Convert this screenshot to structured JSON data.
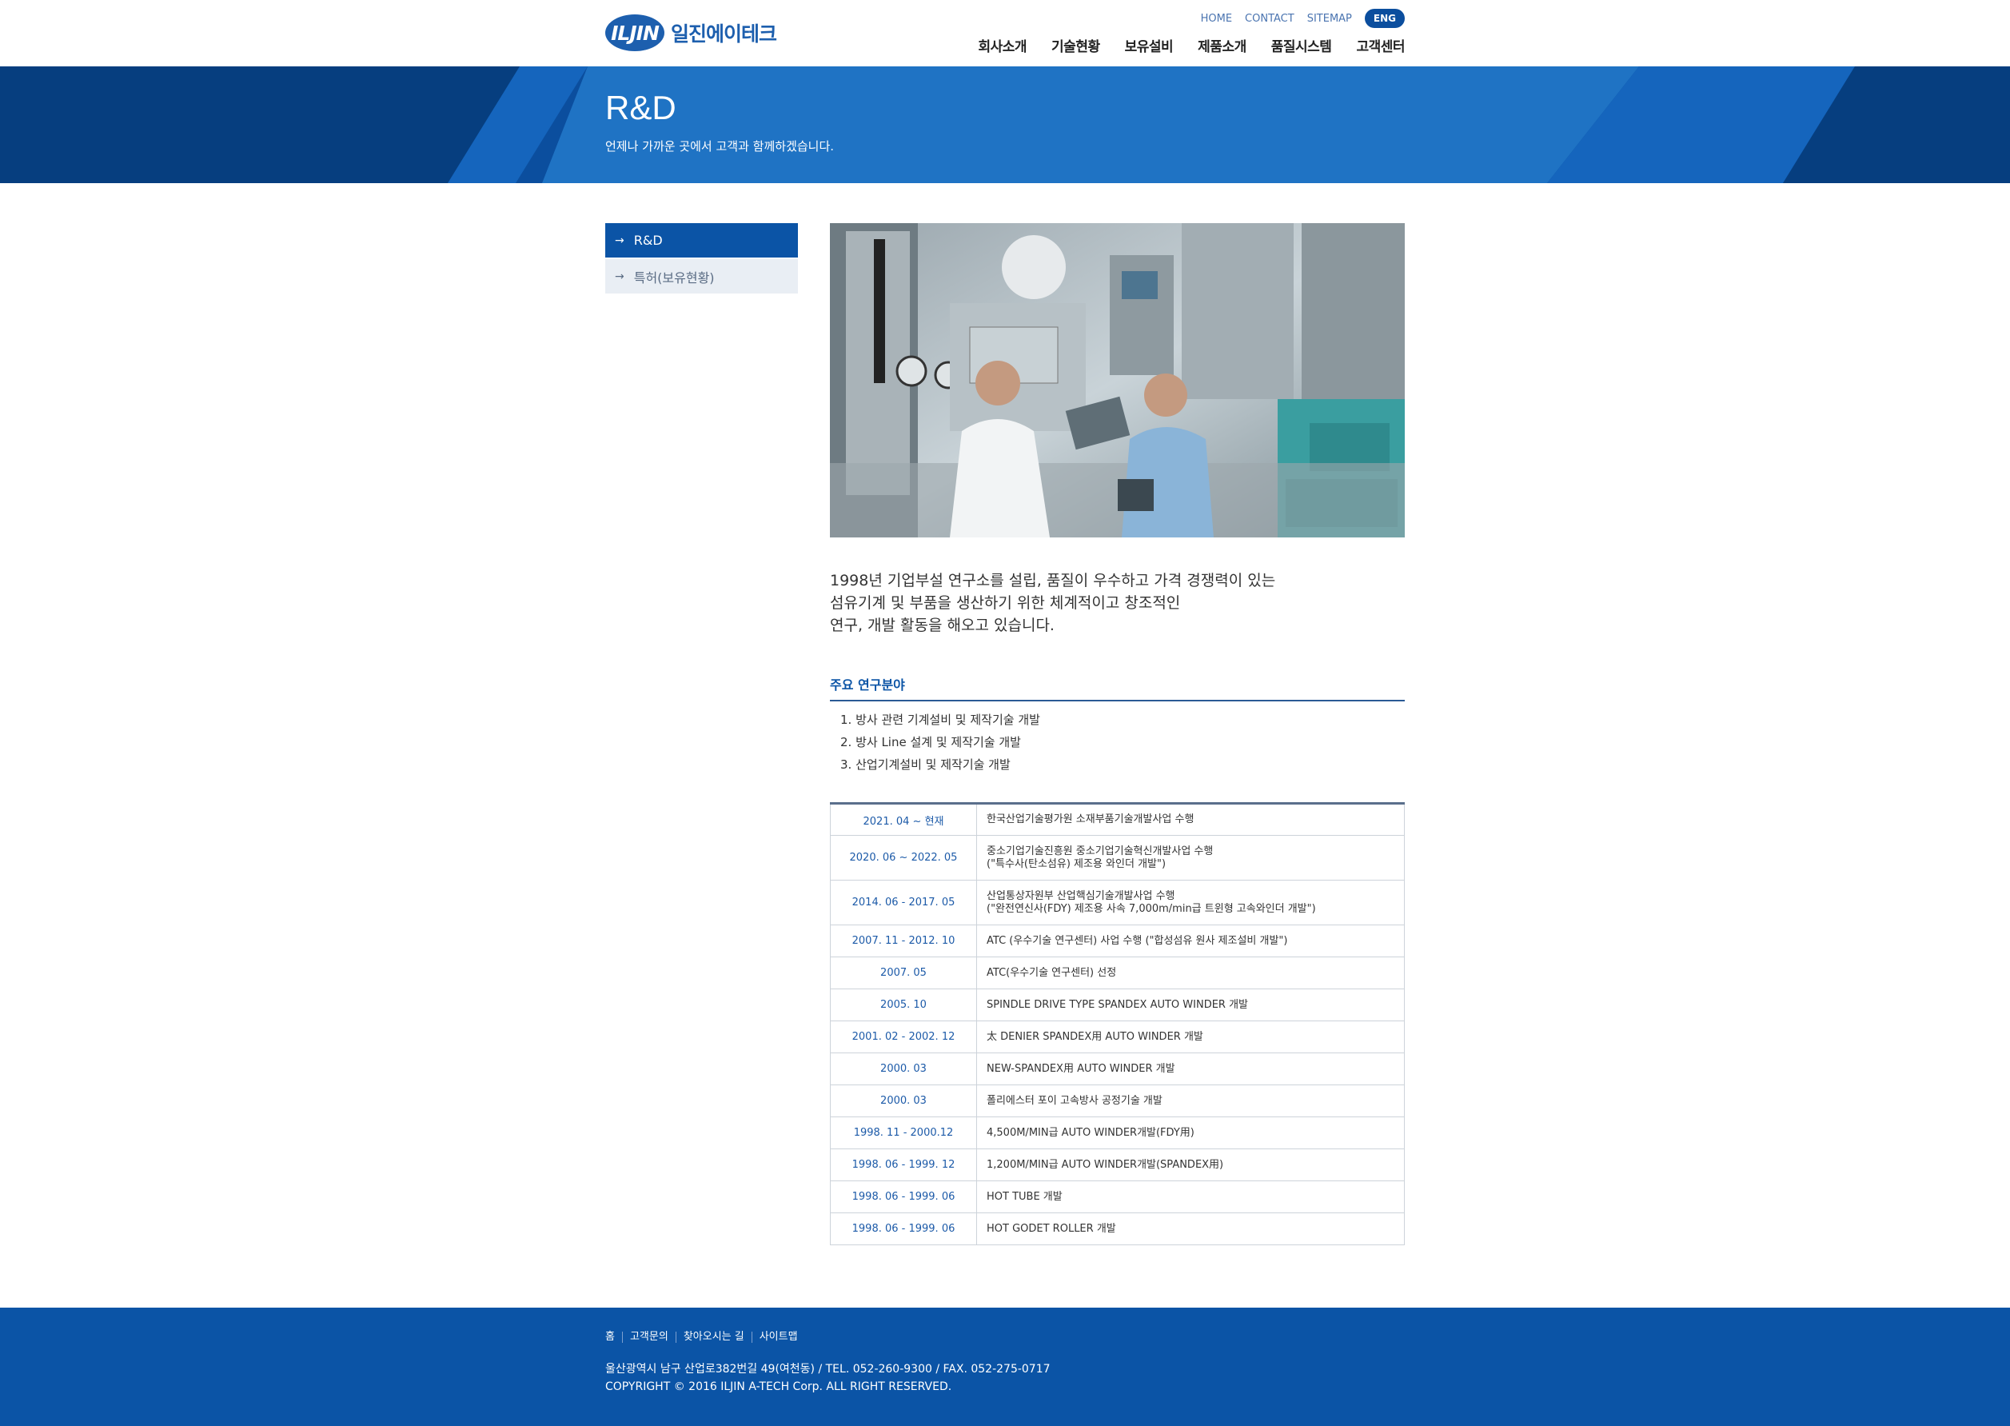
{
  "header": {
    "logo_mark": "ILJIN",
    "logo_text": "일진에이테크",
    "util": [
      "HOME",
      "CONTACT",
      "SITEMAP"
    ],
    "eng": "ENG",
    "gnb": [
      "회사소개",
      "기술현황",
      "보유설비",
      "제품소개",
      "품질시스템",
      "고객센터"
    ]
  },
  "banner": {
    "title": "R&D",
    "subtitle": "언제나 가까운 곳에서 고객과 함께하겠습니다."
  },
  "lnb": {
    "items": [
      {
        "label": "R&D",
        "arrow": "→"
      },
      {
        "label": "특허(보유현황)",
        "arrow": "→"
      }
    ]
  },
  "content": {
    "intro": [
      "1998년 기업부설 연구소를 설립, 품질이 우수하고 가격 경쟁력이 있는",
      "섬유기계 및 부품을 생산하기 위한 체계적이고 창조적인",
      "연구, 개발 활동을 해오고 있습니다."
    ],
    "section_title": "주요 연구분야",
    "research": [
      "1. 방사 관련 기계설비 및 제작기술 개발",
      "2. 방사 Line 설계 및 제작기술 개발",
      "3. 산업기계설비 및 제작기술 개발"
    ],
    "history": [
      {
        "date": "2021. 04 ~ 현재",
        "desc": [
          "한국산업기술평가원 소재부품기술개발사업 수행"
        ]
      },
      {
        "date": "2020. 06 ~ 2022. 05",
        "desc": [
          "중소기업기술진흥원 중소기업기술혁신개발사업 수행",
          "(\"특수사(탄소섬유) 제조용 와인더 개발\")"
        ]
      },
      {
        "date": "2014. 06 - 2017. 05",
        "desc": [
          "산업통상자원부 산업핵심기술개발사업 수행",
          "(\"완전연신사(FDY) 제조용 사속 7,000m/min급 트윈형 고속와인더 개발\")"
        ]
      },
      {
        "date": "2007. 11 - 2012. 10",
        "desc": [
          "ATC (우수기술 연구센터) 사업 수행 (\"합성섬유 원사 제조설비 개발\")"
        ]
      },
      {
        "date": "2007. 05",
        "desc": [
          "ATC(우수기술 연구센터) 선정"
        ]
      },
      {
        "date": "2005. 10",
        "desc": [
          "SPINDLE DRIVE TYPE SPANDEX AUTO WINDER 개발"
        ]
      },
      {
        "date": "2001. 02 - 2002. 12",
        "desc": [
          "太 DENIER SPANDEX用 AUTO WINDER 개발"
        ]
      },
      {
        "date": "2000. 03",
        "desc": [
          "NEW-SPANDEX用 AUTO WINDER 개발"
        ]
      },
      {
        "date": "2000. 03",
        "desc": [
          "폴리에스터 포이 고속방사 공정기술 개발"
        ]
      },
      {
        "date": "1998. 11 - 2000.12",
        "desc": [
          "4,500M/MIN급 AUTO WINDER개발(FDY用)"
        ]
      },
      {
        "date": "1998. 06 - 1999. 12",
        "desc": [
          "1,200M/MIN급 AUTO WINDER개발(SPANDEX用)"
        ]
      },
      {
        "date": "1998. 06 - 1999. 06",
        "desc": [
          "HOT TUBE 개발"
        ]
      },
      {
        "date": "1998. 06 - 1999. 06",
        "desc": [
          "HOT GODET ROLLER 개발"
        ]
      }
    ]
  },
  "footer": {
    "links": [
      "홈",
      "고객문의",
      "찾아오시는 길",
      "사이트맵"
    ],
    "address": "울산광역시 남구 산업로382번길 49(여천동) / TEL. 052-260-9300 / FAX. 052-275-0717",
    "copyright": "COPYRIGHT © 2016 ILJIN A-TECH Corp. ALL RIGHT RESERVED."
  },
  "colors": {
    "brand": "#0b54a6",
    "banner": "#0b4e9e",
    "date_text": "#1c5aa8"
  }
}
